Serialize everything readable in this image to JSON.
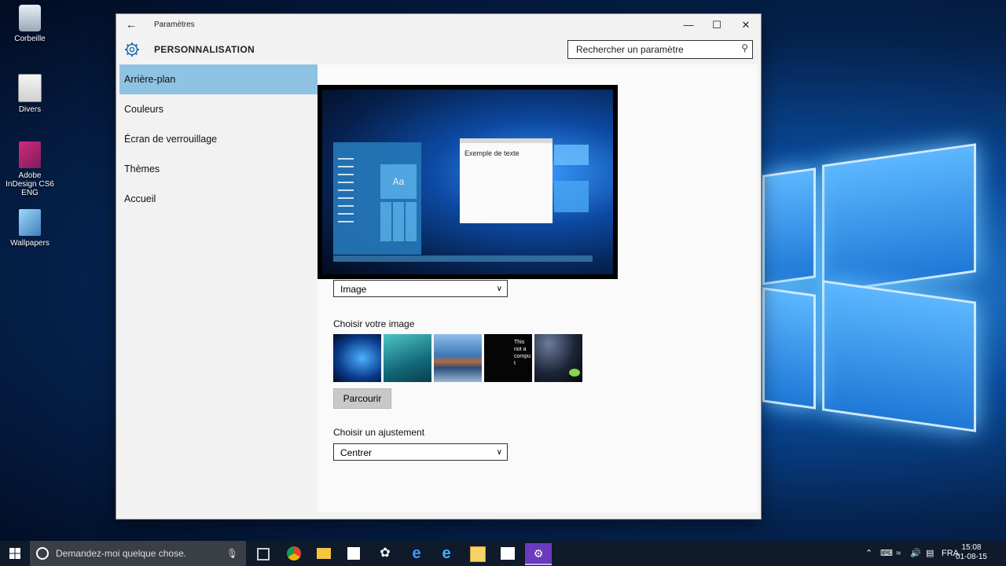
{
  "desktop": {
    "icons": [
      {
        "label": "Corbeille"
      },
      {
        "label": "Divers"
      },
      {
        "label": "Adobe InDesign CS6 ENG"
      },
      {
        "label": "Wallpapers"
      }
    ]
  },
  "window": {
    "title": "Paramètres",
    "back_icon": "back-arrow-icon",
    "controls": {
      "minimize": "—",
      "maximize": "☐",
      "close": "✕"
    }
  },
  "header": {
    "section": "PERSONNALISATION",
    "search_placeholder": "Rechercher un paramètre"
  },
  "sidebar": {
    "items": [
      {
        "label": "Arrière-plan",
        "active": true
      },
      {
        "label": "Couleurs"
      },
      {
        "label": "Écran de verrouillage"
      },
      {
        "label": "Thèmes"
      },
      {
        "label": "Accueil"
      }
    ]
  },
  "preview": {
    "sample_text": "Exemple de texte",
    "tile_label": "Aa"
  },
  "background": {
    "type_value": "Image",
    "choose_image_label": "Choisir votre image",
    "thumbnail_text": "This not a comput",
    "browse_label": "Parcourir",
    "fit_label": "Choisir un ajustement",
    "fit_value": "Centrer"
  },
  "taskbar": {
    "search_text": "Demandez-moi quelque chose.",
    "language": "FRA",
    "time": "15:08",
    "date": "01-08-15"
  },
  "colors": {
    "accent": "#8fc3e3",
    "taskbar": "#0f1a2a"
  }
}
